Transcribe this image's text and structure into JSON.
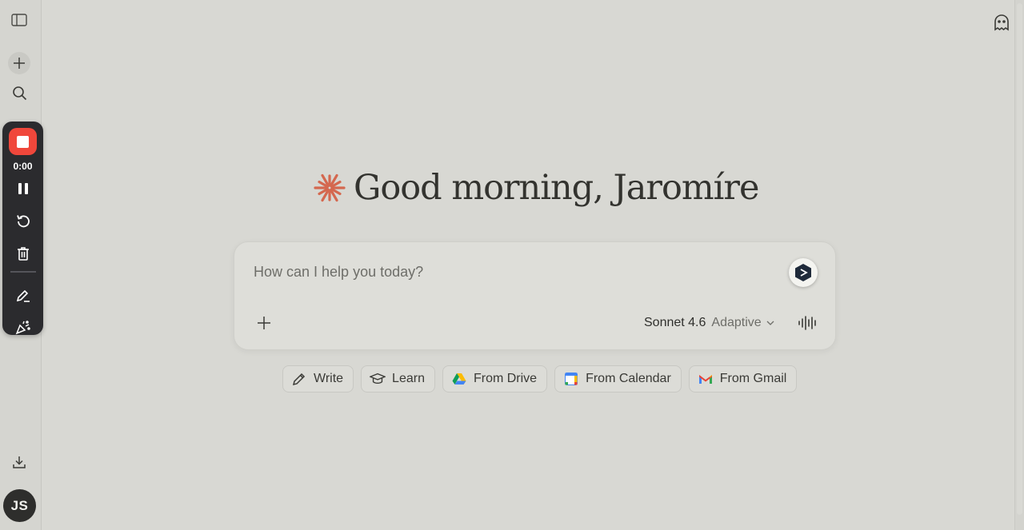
{
  "greeting": {
    "text": "Good morning, Jaromíre",
    "logo_icon": "sparkle-asterisk-icon",
    "accent_color": "#d4684f"
  },
  "composer": {
    "placeholder": "How can I help you today?",
    "value": "",
    "model_name": "Sonnet 4.6",
    "model_mode": "Adaptive"
  },
  "chips": [
    {
      "label": "Write",
      "icon": "pencil-icon"
    },
    {
      "label": "Learn",
      "icon": "graduation-cap-icon"
    },
    {
      "label": "From Drive",
      "icon": "google-drive-icon"
    },
    {
      "label": "From Calendar",
      "icon": "google-calendar-icon"
    },
    {
      "label": "From Gmail",
      "icon": "gmail-icon"
    }
  ],
  "sidebar": {
    "avatar_initials": "JS",
    "icons": [
      "sidebar-toggle-icon",
      "plus-icon",
      "search-icon",
      "download-icon"
    ]
  },
  "recorder": {
    "time": "0:00",
    "stop_color": "#f0473b",
    "icons": [
      "stop-icon",
      "pause-icon",
      "restart-icon",
      "trash-icon",
      "pen-icon",
      "celebrate-icon"
    ]
  },
  "top_right": {
    "icon": "ghost-icon"
  }
}
